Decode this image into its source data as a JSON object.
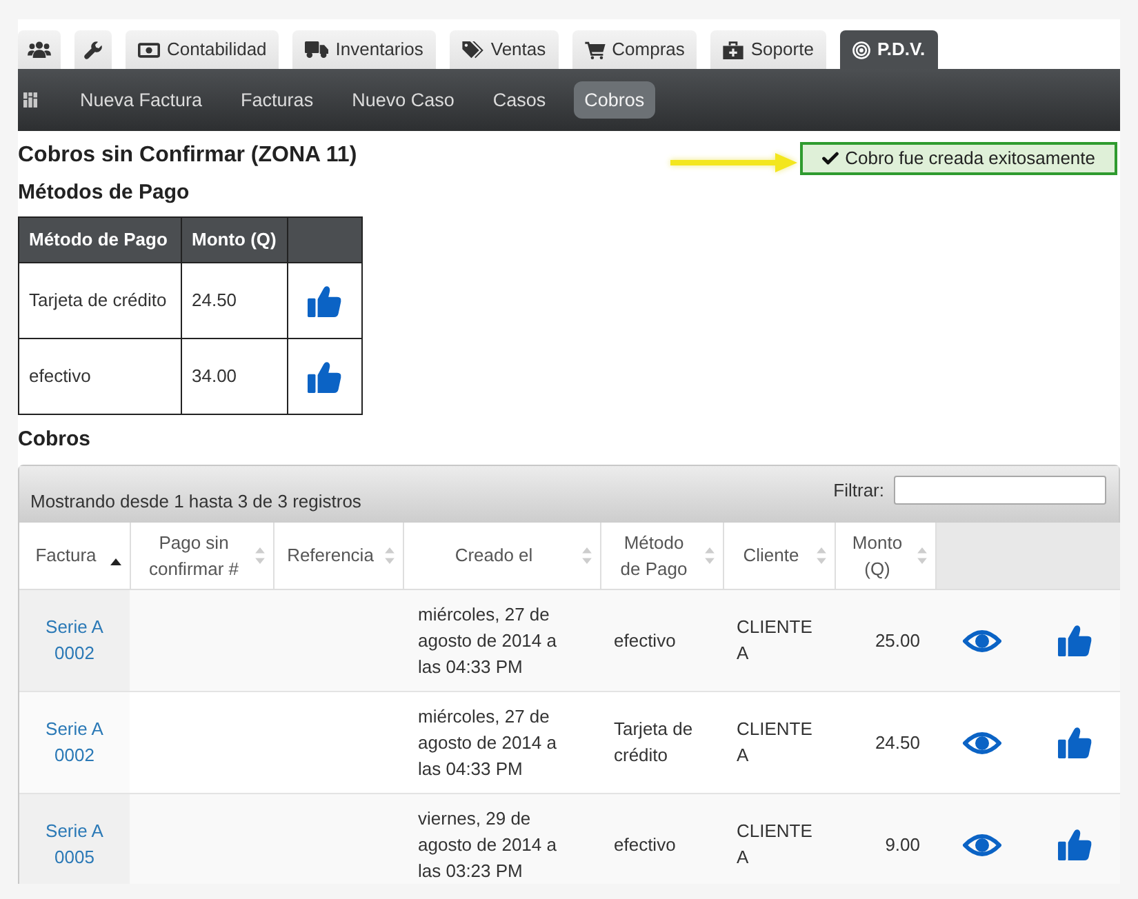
{
  "tabs": [
    {
      "selected": false
    },
    {
      "selected": false
    },
    {
      "label": "Contabilidad",
      "selected": false
    },
    {
      "label": "Inventarios",
      "selected": false
    },
    {
      "label": "Ventas",
      "selected": false
    },
    {
      "label": "Compras",
      "selected": false
    },
    {
      "label": "Soporte",
      "selected": false
    },
    {
      "label": "P.D.V.",
      "selected": true
    }
  ],
  "subnav": [
    {
      "label": "Nueva Factura",
      "selected": false
    },
    {
      "label": "Facturas",
      "selected": false
    },
    {
      "label": "Nuevo Caso",
      "selected": false
    },
    {
      "label": "Casos",
      "selected": false
    },
    {
      "label": "Cobros",
      "selected": true
    }
  ],
  "page_title": "Cobros sin Confirmar (ZONA 11)",
  "alert": {
    "message": "Cobro fue creada exitosamente"
  },
  "payment_methods": {
    "title": "Métodos de Pago",
    "columns": [
      "Método de Pago",
      "Monto (Q)"
    ],
    "rows": [
      {
        "method": "Tarjeta de crédito",
        "amount": "24.50"
      },
      {
        "method": "efectivo",
        "amount": "34.00"
      }
    ]
  },
  "charges": {
    "title": "Cobros",
    "info": "Mostrando desde 1 hasta 3 de 3 registros",
    "filter_label": "Filtrar:",
    "columns": [
      {
        "label": "Factura",
        "sorted": true
      },
      {
        "label": "Pago sin confirmar #",
        "sorted": false
      },
      {
        "label": "Referencia",
        "sorted": false
      },
      {
        "label": "Creado el",
        "sorted": false
      },
      {
        "label": "Método de Pago",
        "sorted": false
      },
      {
        "label": "Cliente",
        "sorted": false
      },
      {
        "label": "Monto (Q)",
        "sorted": false
      }
    ],
    "rows": [
      {
        "invoice": "Serie A 0002",
        "created": "miércoles, 27 de agosto de 2014 a las 04:33 PM",
        "payment_method": "efectivo",
        "client": "CLIENTE A",
        "amount": "25.00"
      },
      {
        "invoice": "Serie A 0002",
        "created": "miércoles, 27 de agosto de 2014 a las 04:33 PM",
        "payment_method": "Tarjeta de crédito",
        "client": "CLIENTE A",
        "amount": "24.50"
      },
      {
        "invoice": "Serie A 0005",
        "created": "viernes, 29 de agosto de 2014 a las 03:23 PM",
        "payment_method": "efectivo",
        "client": "CLIENTE A",
        "amount": "9.00"
      }
    ]
  }
}
